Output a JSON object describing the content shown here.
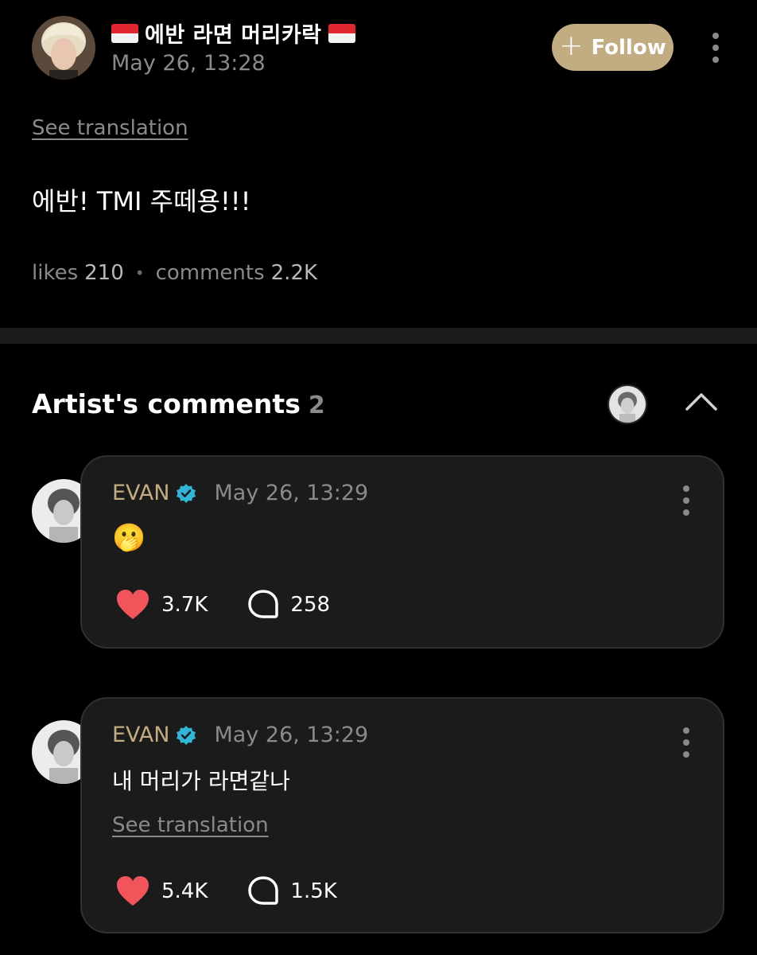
{
  "post": {
    "author": "에반 라면 머리카락",
    "author_flags": [
      "indonesia-flag",
      "indonesia-flag"
    ],
    "timestamp": "May 26, 13:28",
    "follow_label": "Follow",
    "see_translation": "See translation",
    "text": "에반! TMI 주떼용!!!",
    "likes_label": "likes",
    "likes_value": "210",
    "comments_label": "comments",
    "comments_value": "2.2K"
  },
  "artist_comments": {
    "title": "Artist's comments",
    "count": "2",
    "comments": [
      {
        "author": "EVAN",
        "timestamp": "May 26, 13:29",
        "text": "🫢",
        "likes": "3.7K",
        "replies": "258"
      },
      {
        "author": "EVAN",
        "timestamp": "May 26, 13:29",
        "text": "내 머리가 라면같나",
        "see_translation": "See translation",
        "likes": "5.4K",
        "replies": "1.5K"
      }
    ]
  },
  "colors": {
    "background": "#000000",
    "accent": "#c2ad82",
    "like": "#f2545b",
    "verified": "#31b6d8",
    "muted_text": "#8a8a8a",
    "card": "#1b1b1b"
  }
}
